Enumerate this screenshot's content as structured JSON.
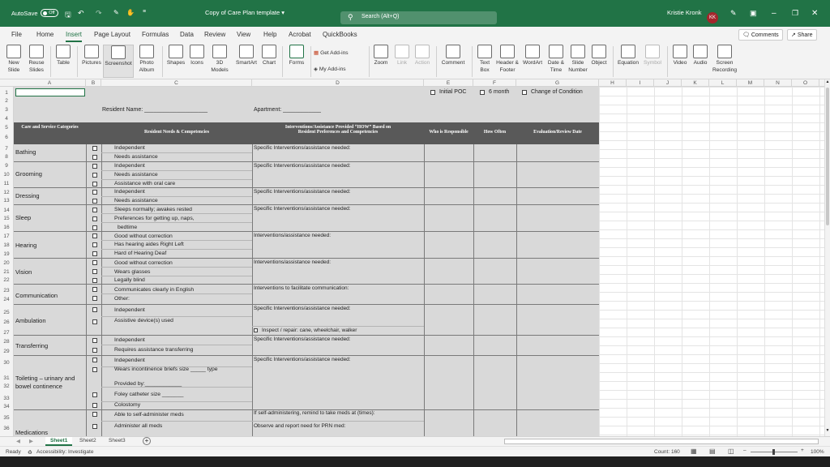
{
  "titlebar": {
    "autosave_label": "AutoSave",
    "autosave_state": "Off",
    "doc_title": "Copy of Care Plan template",
    "search_placeholder": "Search (Alt+Q)",
    "user_name": "Kristie Kronk",
    "user_initials": "KK",
    "accent_color": "#217346"
  },
  "menu": {
    "items": [
      "File",
      "Home",
      "Insert",
      "Page Layout",
      "Formulas",
      "Data",
      "Review",
      "View",
      "Help",
      "Acrobat",
      "QuickBooks"
    ],
    "active": "Insert",
    "comments_label": "Comments",
    "share_label": "Share"
  },
  "ribbon": {
    "new_slide": "New Slide",
    "reuse_slides": "Reuse Slides",
    "table": "Table",
    "pictures": "Pictures",
    "screenshot": "Screenshot",
    "photo_album": "Photo Album",
    "shapes": "Shapes",
    "icons": "Icons",
    "models_3d": "3D Models",
    "smartart": "SmartArt",
    "chart": "Chart",
    "forms": "Forms",
    "get_addins": "Get Add-ins",
    "my_addins": "My Add-ins",
    "zoom": "Zoom",
    "link": "Link",
    "action": "Action",
    "comment": "Comment",
    "text_box": "Text Box",
    "header_footer": "Header & Footer",
    "wordart": "WordArt",
    "date_time": "Date & Time",
    "slide_number": "Slide Number",
    "object": "Object",
    "equation": "Equation",
    "symbol": "Symbol",
    "video": "Video",
    "audio": "Audio",
    "screen_recording": "Screen Recording"
  },
  "columns": [
    "A",
    "B",
    "C",
    "D",
    "E",
    "F",
    "G",
    "H",
    "I",
    "J",
    "K",
    "L",
    "M",
    "N",
    "O"
  ],
  "rows": [
    "1",
    "2",
    "3",
    "4",
    "5",
    "6",
    "7",
    "8",
    "9",
    "10",
    "11",
    "12",
    "13",
    "14",
    "15",
    "16",
    "17",
    "18",
    "19",
    "20",
    "21",
    "22",
    "23",
    "24",
    "25",
    "26",
    "27",
    "28",
    "29",
    "30",
    "31",
    "32",
    "33",
    "34",
    "35",
    "36"
  ],
  "form": {
    "initial_poc": "Initial POC",
    "six_month": "6 month",
    "change_of_condition": "Change of Condition",
    "resident_name": "Resident Name: ____________________",
    "apartment": "Apartment: ____________",
    "hdr_care_categories": "Care and Service Categories",
    "hdr_needs": "Resident Needs & Competencies",
    "hdr_interventions": "Interventions/Assistance Provided “HOW” Based on Resident Preferences and Competencies",
    "hdr_who": "Who is Responsible",
    "hdr_how_often": "How Often",
    "hdr_evaluation": "Evaluation/Review Date",
    "categories": [
      "Bathing",
      "Grooming",
      "Dressing",
      "Sleep",
      "Hearing",
      "Vision",
      "Communication",
      "Ambulation",
      "Transferring",
      "Toileting – urinary and bowel continence",
      "Medications"
    ],
    "options": {
      "bathing": [
        "Independent",
        "Needs assistance"
      ],
      "grooming": [
        "Independent",
        "Needs assistance",
        "Assistance with oral care"
      ],
      "dressing": [
        "Independent",
        "Needs assistance"
      ],
      "sleep": [
        "Sleeps normally; awakes rested",
        "Preferences for getting up, naps,",
        "bedtime"
      ],
      "hearing": [
        "Good without correction",
        "Has hearing aides     Right   Left",
        "Hard of Hearing              Deaf"
      ],
      "vision": [
        "Good without correction",
        "Wears glasses",
        "Legally blind"
      ],
      "communication": [
        "Communicates clearly in English",
        "Other:"
      ],
      "ambulation": [
        "Independent",
        "Assistive device(s) used"
      ],
      "transferring": [
        "Independent",
        "Requires assistance transferring"
      ],
      "toileting": [
        "Independent",
        "Wears incontinence briefs   size _____        type",
        "Provided by:____________",
        "Foley catheter  size _______",
        "Colostomy"
      ],
      "medications": [
        "Able to self-administer meds",
        "Administer all meds"
      ]
    },
    "interventions": {
      "specific": "Specific Interventions/assistance needed:",
      "general": "Interventions/assistance needed:",
      "communication": "Interventions to facilitate communication:",
      "ambulation_repair": "Inspect / repair: cane, wheelchair, walker",
      "medications_remind": "If self-administering, remind to take meds at (times):",
      "medications_prn": "Observe and report need for PRN med:"
    }
  },
  "sheets": [
    "Sheet1",
    "Sheet2",
    "Sheet3"
  ],
  "active_sheet": "Sheet1",
  "status": {
    "ready": "Ready",
    "accessibility": "Accessibility: Investigate",
    "count": "Count: 160",
    "zoom": "100%"
  }
}
